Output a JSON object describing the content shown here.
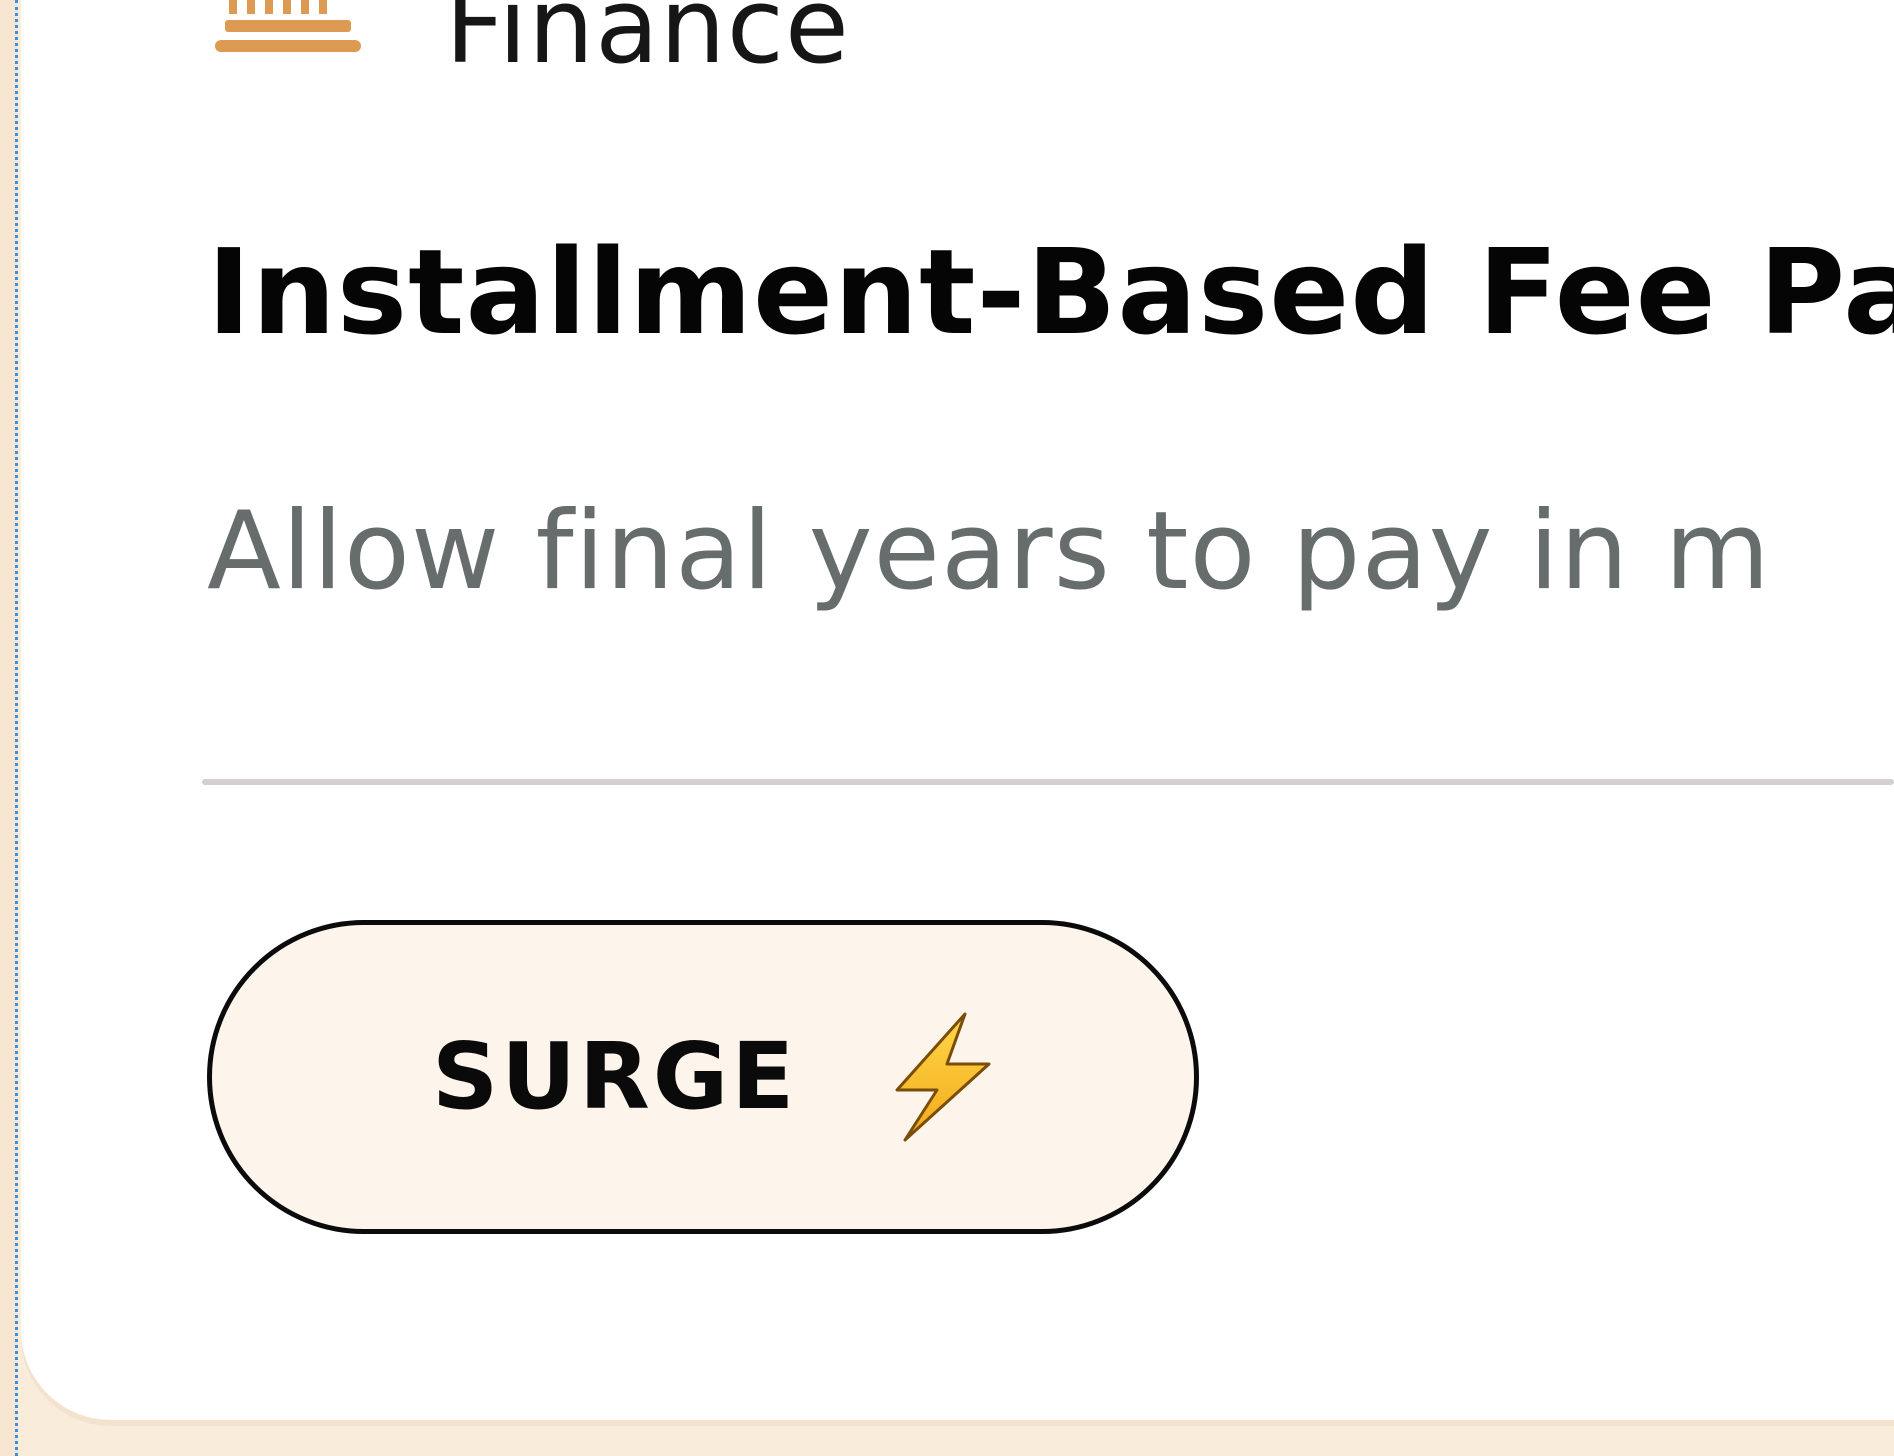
{
  "card": {
    "category": {
      "label": "Finance",
      "icon": "bank-columns-icon",
      "icon_color": "#dc9a52"
    },
    "title": "Installment-Based Fee Pa",
    "subtitle": "Allow final years to pay in m",
    "action": {
      "label": "SURGE",
      "icon": "lightning-bolt-icon",
      "background": "#fdf5eb"
    }
  }
}
